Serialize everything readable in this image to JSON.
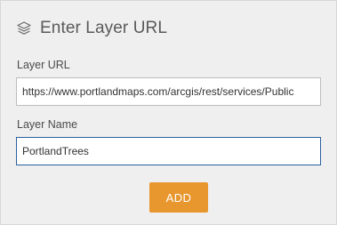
{
  "header": {
    "icon": "layers-icon",
    "title": "Enter Layer URL"
  },
  "form": {
    "url_label": "Layer URL",
    "url_value": "https://www.portlandmaps.com/arcgis/rest/services/Public",
    "name_label": "Layer Name",
    "name_value": "PortlandTrees",
    "add_label": "ADD"
  },
  "colors": {
    "accent": "#e8962e",
    "focus_border": "#2c5e9e",
    "panel_bg": "#efefef"
  }
}
